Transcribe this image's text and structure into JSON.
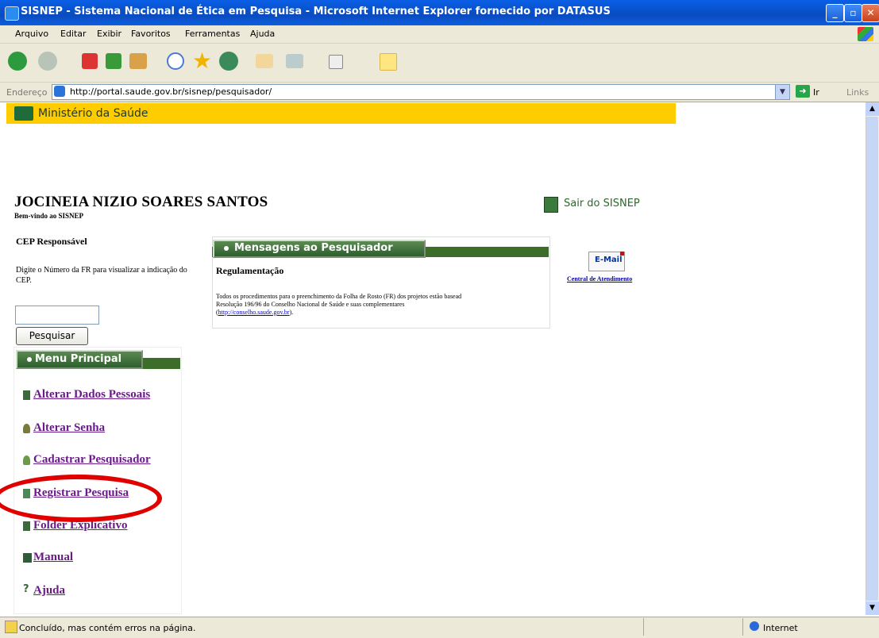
{
  "window": {
    "title": "SISNEP - Sistema Nacional de Ética em Pesquisa - Microsoft Internet Explorer fornecido por DATASUS"
  },
  "menu_bar": {
    "items": [
      "Arquivo",
      "Editar",
      "Exibir",
      "Favoritos",
      "Ferramentas",
      "Ajuda"
    ]
  },
  "address_bar": {
    "label": "Endereço",
    "url": "http://portal.saude.gov.br/sisnep/pesquisador/",
    "go_label": "Ir",
    "links_label": "Links"
  },
  "banner": {
    "text": "Ministério da Saúde"
  },
  "user": {
    "name": "JOCINEIA NIZIO SOARES SANTOS",
    "welcome": "Bem-vindo ao SISNEP"
  },
  "logout": {
    "label": "Sair do SISNEP"
  },
  "cep": {
    "title": "CEP Responsável",
    "description": "Digite o Número da FR para visualizar a indicação do CEP.",
    "input_value": "",
    "search_label": "Pesquisar"
  },
  "main_menu": {
    "title": "Menu Principal",
    "items": [
      {
        "label": "Alterar Dados Pessoais",
        "icon": "document-icon"
      },
      {
        "label": "Alterar Senha",
        "icon": "key-icon"
      },
      {
        "label": "Cadastrar Pesquisador",
        "icon": "user-add-icon"
      },
      {
        "label": "Registrar Pesquisa",
        "icon": "form-icon"
      },
      {
        "label": "Folder Explicativo",
        "icon": "document-icon"
      },
      {
        "label": "Manual",
        "icon": "book-icon"
      },
      {
        "label": "Ajuda",
        "icon": "help-icon"
      }
    ]
  },
  "messages": {
    "title": "Mensagens ao Pesquisador",
    "heading": "Regulamentação",
    "body_line1": "Todos os procedimentos para o preenchimento da Folha de Rosto (FR) dos projetos estão basead",
    "body_line2": "Resolução 196/96 do Conselho Nacional de Saúde e suas complementares",
    "link_open": "(",
    "link": "http://conselho.saude.gov.br",
    "link_close": ")."
  },
  "support": {
    "email_label": "E-Mail",
    "central_label": "Central de Atendimento"
  },
  "status_bar": {
    "text": "Concluído, mas contém erros na página.",
    "zone": "Internet"
  },
  "colors": {
    "banner": "#ffcc00",
    "header_green": "#3c6e2a",
    "link_purple": "#6b1a8a",
    "annotation": "#e00000"
  }
}
